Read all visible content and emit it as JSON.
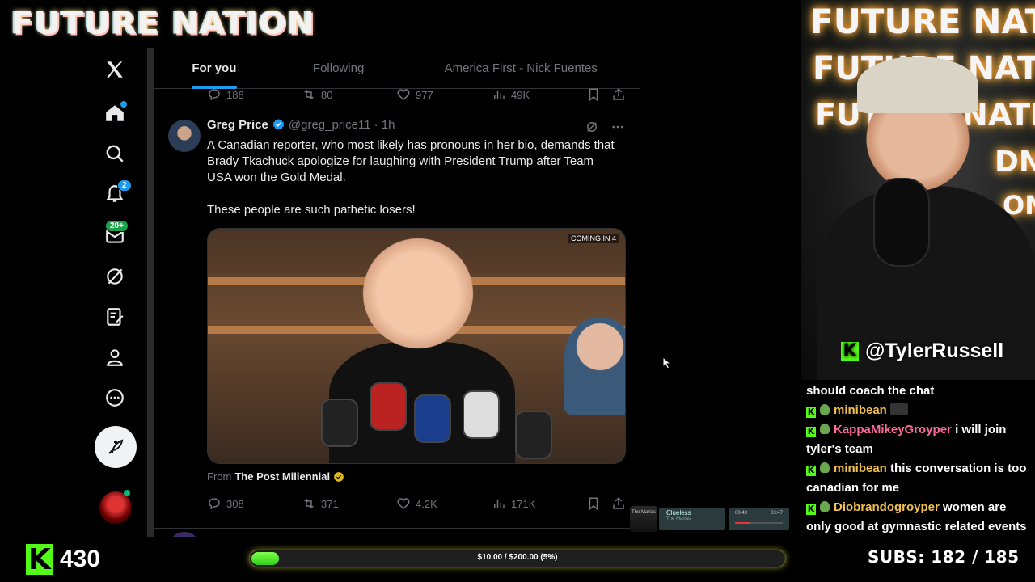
{
  "stream": {
    "title": "FUTURE NATION",
    "webcam_neon": [
      "FUTURE NATION",
      "FUTURE NATION",
      "FUTURE NATION",
      "DN",
      "ON"
    ],
    "streamer_name": "@TylerRussell",
    "kick_letter": "K",
    "followers": "430",
    "goal_text": "$10.00 / $200.00 (5%)",
    "goal_progress": 0.05,
    "subs_label": "SUBS:",
    "subs_value": "182 / 185",
    "now_playing": {
      "song": "Clueless",
      "artist": "The Marias",
      "elapsed": "00:43",
      "total": "03:47",
      "logo_text": "The Marias"
    },
    "accent": "#53fc18"
  },
  "x": {
    "badges": {
      "notifications": "2",
      "messages": "20+"
    },
    "tabs": [
      {
        "label": "For you",
        "active": true
      },
      {
        "label": "Following",
        "active": false
      },
      {
        "label": "America First - Nick Fuentes",
        "active": false
      }
    ],
    "prev_tweet_stats": {
      "replies": "188",
      "reposts": "80",
      "likes": "977",
      "views": "49K"
    },
    "tweet": {
      "name": "Greg Price",
      "handle": "@greg_price11",
      "time": "· 1h",
      "text_1": "A Canadian reporter, who most likely has pronouns in her bio, demands that Brady Tkachuck apologize for laughing with President Trump after Team USA won the Gold Medal.",
      "text_2": "These people are such pathetic losers!",
      "media_tag": "COMING IN 4",
      "from_label": "From",
      "from_source": "The Post Millennial",
      "replies": "308",
      "reposts": "371",
      "likes": "4.2K",
      "views": "171K"
    },
    "accent": "#1d9bf0"
  },
  "chat": [
    {
      "user": "",
      "message": "should coach the chat",
      "color": "#ffffff",
      "badges": false
    },
    {
      "user": "minibean",
      "message": "",
      "color": "#f2c14e",
      "badges": true,
      "emote": true
    },
    {
      "user": "KappaMikeyGroyper",
      "message": "i will join tyler's team",
      "color": "#ff6b9a",
      "badges": true
    },
    {
      "user": "minibean",
      "message": "this conversation is too canadian for me",
      "color": "#f2c14e",
      "badges": true
    },
    {
      "user": "Diobrandogroyper",
      "message": "women are only good at gymnastic related events",
      "color": "#f2c14e",
      "badges": true
    }
  ]
}
